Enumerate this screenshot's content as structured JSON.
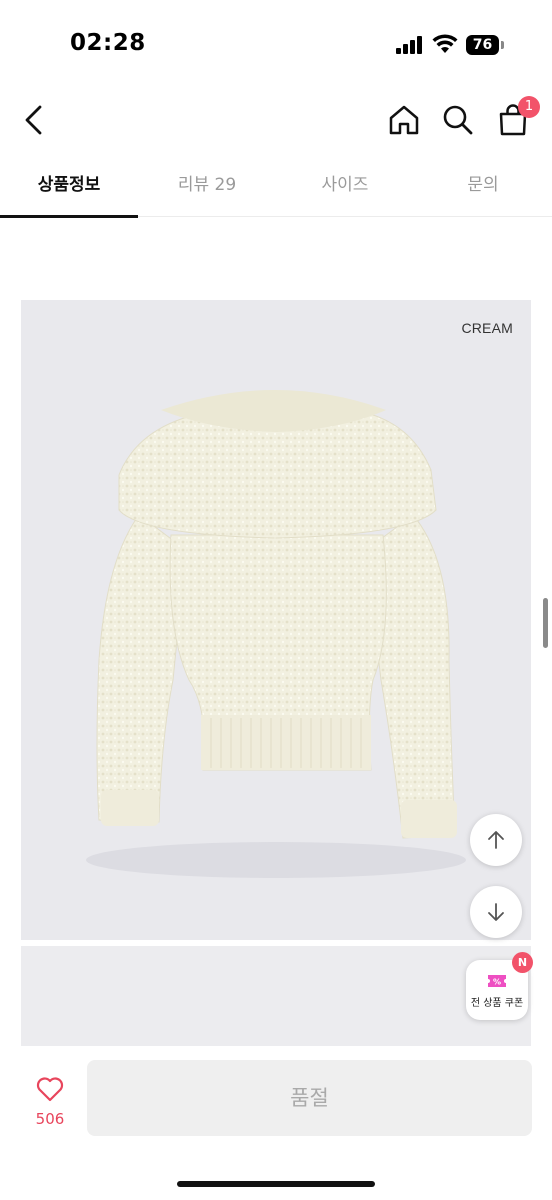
{
  "status_bar": {
    "time": "02:28",
    "battery": "76",
    "icons": [
      "signal-icon",
      "wifi-icon",
      "battery-icon"
    ]
  },
  "header": {
    "icons": [
      "back-chevron-icon",
      "home-icon",
      "search-icon",
      "shopping-bag-icon"
    ],
    "cart_count": "1"
  },
  "tabs": [
    {
      "label": "상품정보",
      "active": true
    },
    {
      "label": "리뷰 29",
      "active": false
    },
    {
      "label": "사이즈",
      "active": false
    },
    {
      "label": "문의",
      "active": false
    }
  ],
  "product": {
    "color_label": "CREAM"
  },
  "floating": {
    "coupon_label": "전 상품 쿠폰",
    "new_badge": "N",
    "icons": [
      "arrow-up-icon",
      "arrow-down-icon",
      "coupon-ticket-icon"
    ]
  },
  "bottom_bar": {
    "like_count": "506",
    "buy_label": "품절",
    "icons": [
      "heart-icon"
    ]
  },
  "colors": {
    "accent": "#f2536a",
    "like": "#e8455c",
    "image_bg": "#e9e9ed",
    "sweater": "#f3f1e2",
    "disabled_button": "#efefef"
  }
}
